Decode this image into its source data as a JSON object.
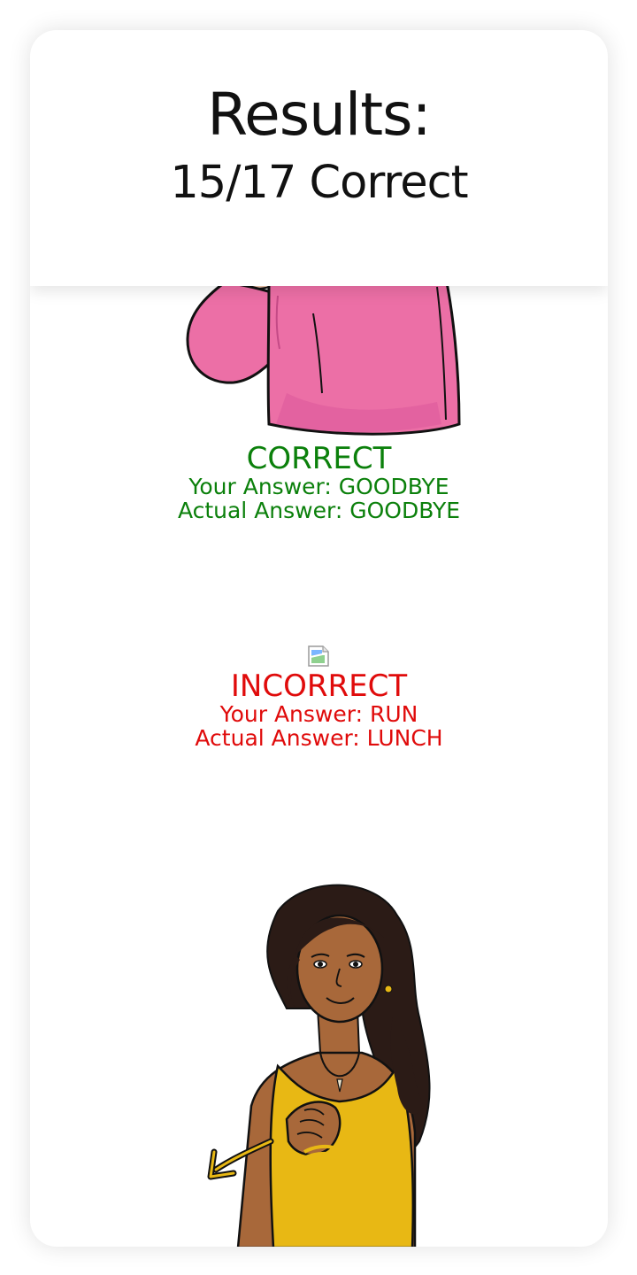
{
  "header": {
    "title": "Results:",
    "score": "15/17 Correct"
  },
  "results": [
    {
      "status": "CORRECT",
      "your_answer": "Your Answer: GOODBYE",
      "actual_answer": "Actual Answer: GOODBYE",
      "color": "#0b800b",
      "illustration": "pink-sweater-signer-image"
    },
    {
      "status": "INCORRECT",
      "your_answer": "Your Answer: RUN",
      "actual_answer": "Actual Answer: LUNCH",
      "color": "#e00b0b",
      "illustration": "broken-image-icon"
    },
    {
      "illustration": "yellow-top-signer-image"
    }
  ],
  "colors": {
    "correct": "#0b800b",
    "incorrect": "#e00b0b",
    "pink_sweater": "#ec6fa6",
    "yellow_top": "#e8b814",
    "skin": "#a8683a",
    "hair": "#2b1b16"
  }
}
